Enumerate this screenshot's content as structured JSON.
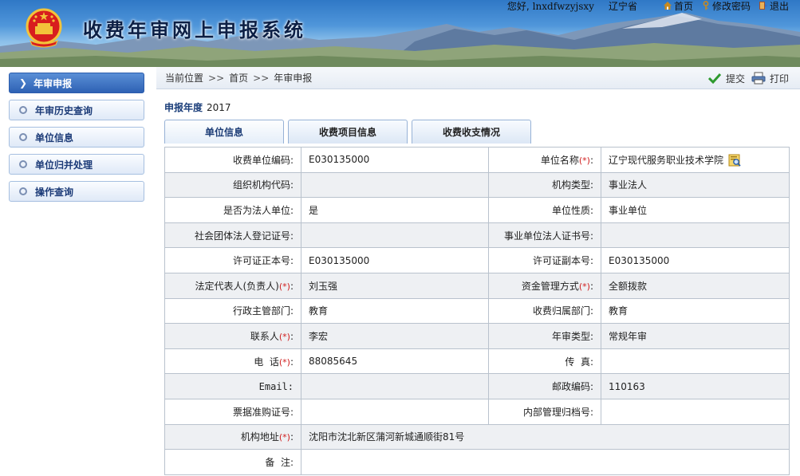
{
  "header": {
    "system_title": "收费年审网上申报系统",
    "greeting_prefix": "您好,",
    "username": "lnxdfwzyjsxy",
    "province": "辽宁省",
    "links": {
      "home": "首页",
      "change_password": "修改密码",
      "logout": "退出"
    }
  },
  "sidebar": {
    "items": [
      {
        "label": "年审申报",
        "active": true
      },
      {
        "label": "年审历史查询",
        "active": false
      },
      {
        "label": "单位信息",
        "active": false
      },
      {
        "label": "单位归并处理",
        "active": false
      },
      {
        "label": "操作查询",
        "active": false
      }
    ]
  },
  "breadcrumb": {
    "prefix": "当前位置",
    "separator": ">>",
    "home": "首页",
    "current": "年审申报"
  },
  "actions": {
    "submit": "提交",
    "print": "打印"
  },
  "report_year": {
    "label": "申报年度",
    "value": "2017"
  },
  "tabs": [
    {
      "label": "单位信息",
      "active": true
    },
    {
      "label": "收费项目信息",
      "active": false
    },
    {
      "label": "收费收支情况",
      "active": false
    }
  ],
  "form": {
    "required_mark": "(*)",
    "unit_code_label": "收费单位编码:",
    "unit_code": "E030135000",
    "unit_name_label": "单位名称",
    "unit_name": "辽宁现代服务职业技术学院",
    "org_code_label": "组织机构代码:",
    "org_code": "",
    "org_type_label": "机构类型:",
    "org_type": "事业法人",
    "legal_entity_label": "是否为法人单位:",
    "legal_entity": "是",
    "unit_nature_label": "单位性质:",
    "unit_nature": "事业单位",
    "social_cert_label": "社会团体法人登记证号:",
    "social_cert": "",
    "public_cert_label": "事业单位法人证书号:",
    "public_cert": "",
    "license_main_label": "许可证正本号:",
    "license_main": "E030135000",
    "license_copy_label": "许可证副本号:",
    "license_copy": "E030135000",
    "legal_rep_label": "法定代表人(负责人)",
    "legal_rep": "刘玉强",
    "fund_mgmt_label": "资金管理方式",
    "fund_mgmt": "全额拨款",
    "admin_dept_label": "行政主管部门:",
    "admin_dept": "教育",
    "fee_dept_label": "收费归属部门:",
    "fee_dept": "教育",
    "contact_label": "联系人",
    "contact": "李宏",
    "review_type_label": "年审类型:",
    "review_type": "常规年审",
    "phone_label": "电  话",
    "phone": "88085645",
    "fax_label": "传  真:",
    "fax": "",
    "email_label": "Email:",
    "email": "",
    "postcode_label": "邮政编码:",
    "postcode": "110163",
    "ticket_cert_label": "票据准购证号:",
    "ticket_cert": "",
    "archive_no_label": "内部管理归档号:",
    "archive_no": "",
    "address_label": "机构地址",
    "address": "沈阳市沈北新区蒲河新城通顺街81号",
    "remark_label": "备  注:",
    "remark": ""
  }
}
